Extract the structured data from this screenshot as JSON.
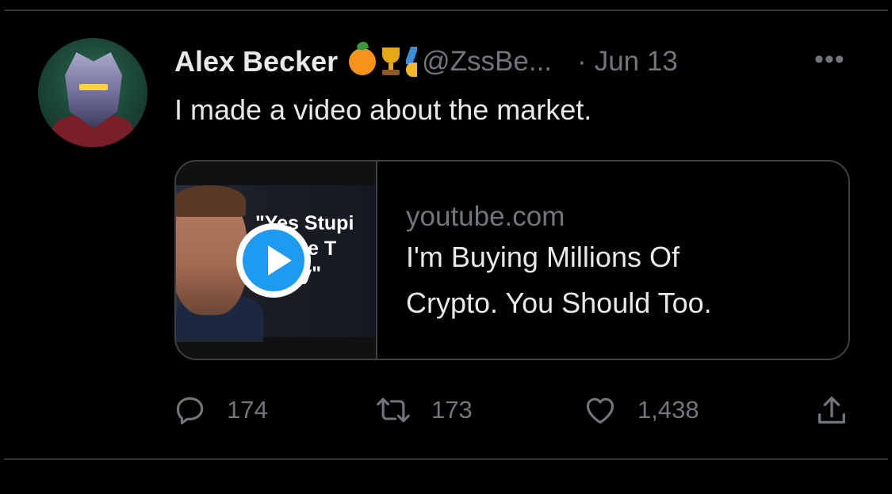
{
  "tweet": {
    "author_name": "Alex Becker",
    "badge_icons": [
      "orange-emoji-icon",
      "trophy-emoji-icon",
      "medal-emoji-icon"
    ],
    "handle": "@ZssBe...",
    "separator": "·",
    "date": "Jun 13",
    "more_label": "•••",
    "text": "I made a video about the market.",
    "card": {
      "thumbnail_caption_lines": [
        "\"Yes Stupi",
        "Time T",
        "Buy\""
      ],
      "domain": "youtube.com",
      "title_line1": "I'm Buying Millions Of",
      "title_line2": "Crypto. You Should Too."
    },
    "actions": {
      "replies": "174",
      "retweets": "173",
      "likes": "1,438"
    }
  },
  "colors": {
    "background": "#000000",
    "text_primary": "#e7e9ea",
    "text_secondary": "#71767b",
    "divider": "#2f3336",
    "accent_play": "#1d9bf0"
  }
}
